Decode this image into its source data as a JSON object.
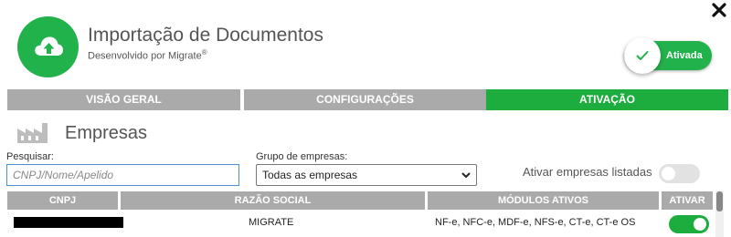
{
  "header": {
    "title": "Importação de Documentos",
    "subtitle": "Desenvolvido por Migrate",
    "subtitle_mark": "®",
    "activation_label": "Ativada"
  },
  "tabs": [
    {
      "label": "VISÃO GERAL",
      "active": false
    },
    {
      "label": "CONFIGURAÇÕES",
      "active": false
    },
    {
      "label": "ATIVAÇÃO",
      "active": true
    }
  ],
  "section": {
    "title": "Empresas",
    "icon": "factory-icon"
  },
  "filters": {
    "search_label": "Pesquisar:",
    "search_placeholder": "CNPJ/Nome/Apelido",
    "search_value": "",
    "group_label": "Grupo de empresas:",
    "group_selected": "Todas as empresas",
    "bulk_activate_label": "Ativar empresas listadas",
    "bulk_activate_on": false
  },
  "table": {
    "columns": [
      "CNPJ",
      "RAZÃO SOCIAL",
      "MÓDULOS ATIVOS",
      "ATIVAR"
    ],
    "rows": [
      {
        "cnpj": "",
        "razao_social": "MIGRATE",
        "modulos": "NF-e, NFC-e, MDF-e, NFS-e, CT-e, CT-e OS",
        "ativo": true
      }
    ]
  },
  "colors": {
    "accent_green": "#1cad3e",
    "logo_green": "#22b24c",
    "tab_inactive": "#aaaaaa"
  }
}
